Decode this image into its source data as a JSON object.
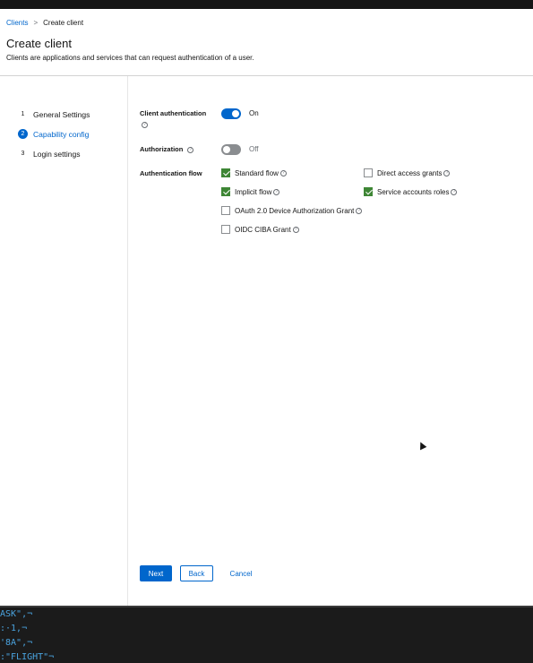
{
  "breadcrumb": {
    "root": "Clients",
    "separator": ">",
    "current": "Create client"
  },
  "header": {
    "title": "Create client",
    "subtitle": "Clients are applications and services that can request authentication of a user."
  },
  "wizard": {
    "steps": [
      {
        "num": "1",
        "label": "General Settings",
        "active": false
      },
      {
        "num": "2",
        "label": "Capability config",
        "active": true
      },
      {
        "num": "3",
        "label": "Login settings",
        "active": false
      }
    ]
  },
  "form": {
    "client_auth": {
      "label": "Client authentication",
      "state": "On",
      "enabled": true
    },
    "authorization": {
      "label": "Authorization",
      "state": "Off",
      "enabled": false
    },
    "auth_flow": {
      "label": "Authentication flow",
      "options": [
        {
          "label": "Standard flow",
          "checked": true
        },
        {
          "label": "Direct access grants",
          "checked": false
        },
        {
          "label": "Implicit flow",
          "checked": true
        },
        {
          "label": "Service accounts roles",
          "checked": true
        },
        {
          "label": "OAuth 2.0 Device Authorization Grant",
          "checked": false
        },
        {
          "label": "OIDC CIBA Grant",
          "checked": false
        }
      ]
    }
  },
  "buttons": {
    "next": "Next",
    "back": "Back",
    "cancel": "Cancel"
  },
  "help_glyph": "?",
  "terminal": {
    "lines": [
      "ASK\",¬",
      ":·1,¬",
      "'8A\",¬",
      ":\"FLIGHT\"¬"
    ]
  },
  "colors": {
    "accent": "#0066cc",
    "checked": "#3e8635",
    "toggle_off": "#8a8d90"
  },
  "icons": [
    "help-icon",
    "check-icon",
    "chevron-right-icon",
    "mouse-cursor-icon"
  ]
}
